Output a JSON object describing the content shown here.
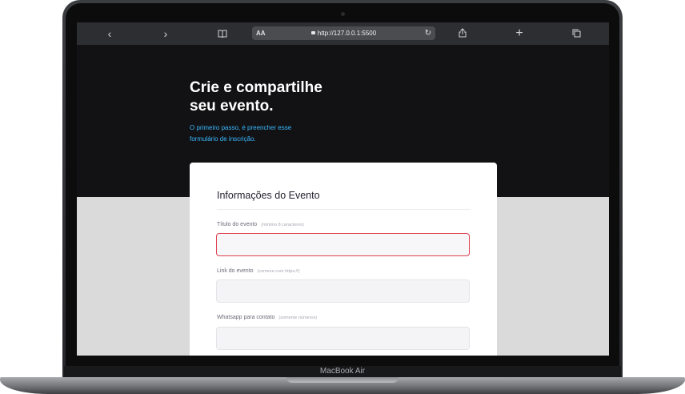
{
  "device": {
    "brand_label": "MacBook Air"
  },
  "browser": {
    "reader_label": "AA",
    "url": "http://127.0.0.1:5500",
    "icons": [
      "chevron-left-icon",
      "chevron-right-icon",
      "book-icon",
      "reload-icon",
      "share-icon",
      "plus-icon",
      "tabs-icon"
    ]
  },
  "hero": {
    "title_line1": "Crie e compartilhe",
    "title_line2": "seu evento.",
    "subtitle_line1": "O primeiro passo, é preencher esse",
    "subtitle_line2": "formulário de inscrição."
  },
  "form": {
    "section_title": "Informações do Evento",
    "fields": [
      {
        "label": "Título do evento",
        "hint": "(mínimo 8 caracteres)",
        "value": "",
        "state": "error"
      },
      {
        "label": "Link do evento",
        "hint": "(comece com https://)",
        "value": ""
      },
      {
        "label": "Whatsapp para contato",
        "hint": "(somente números)",
        "value": ""
      }
    ]
  },
  "colors": {
    "accent": "#3ab8ff",
    "error": "#e0404f",
    "hero_bg": "#121214"
  }
}
